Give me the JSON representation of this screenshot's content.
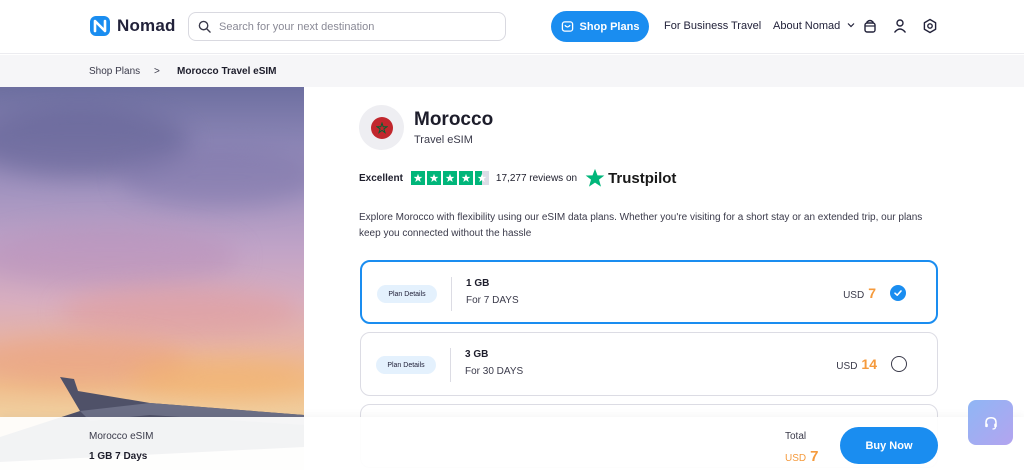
{
  "header": {
    "brand": "Nomad",
    "search_placeholder": "Search for your next destination",
    "shop_plans": "Shop Plans",
    "nav": [
      "For Business",
      "Travel",
      "About Nomad"
    ]
  },
  "breadcrumb": {
    "root": "Shop Plans",
    "separator": ">",
    "current": "Morocco Travel eSIM"
  },
  "product": {
    "country": "Morocco",
    "subtitle": "Travel eSIM",
    "description": "Explore Morocco with flexibility using our eSIM data plans. Whether you're visiting for a short stay or an extended trip, our plans keep you connected without the hassle"
  },
  "rating": {
    "label": "Excellent",
    "stars": 4.5,
    "reviews": "17,277 reviews on",
    "provider": "Trustpilot"
  },
  "plans": [
    {
      "details_label": "Plan Details",
      "data": "1 GB",
      "duration": "For 7 DAYS",
      "currency": "USD",
      "price": "7",
      "selected": true
    },
    {
      "details_label": "Plan Details",
      "data": "3 GB",
      "duration": "For 30 DAYS",
      "currency": "USD",
      "price": "14",
      "selected": false
    }
  ],
  "footer": {
    "product": "Morocco eSIM",
    "summary": "1 GB 7 Days",
    "total_label": "Total",
    "currency": "USD",
    "total": "7",
    "buy": "Buy Now"
  },
  "colors": {
    "accent": "#1a8df0",
    "price": "#f59a3c",
    "trustpilot": "#00b67a",
    "flag": "#c1272d"
  },
  "icons": [
    "nomad-logo-icon",
    "search-icon",
    "store-icon",
    "chevron-down-icon",
    "bag-icon",
    "user-icon",
    "gear-icon",
    "check-icon",
    "star-icon",
    "headset-icon"
  ]
}
